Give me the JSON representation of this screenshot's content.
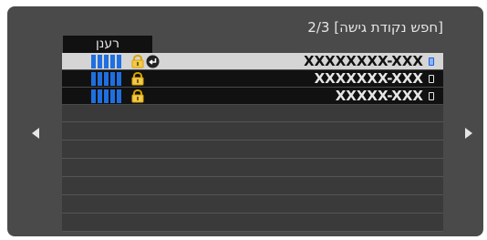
{
  "header": {
    "title": "[חפש נקודת גישה]",
    "page": "2/3"
  },
  "refresh_button": {
    "label": "רענן"
  },
  "networks": [
    {
      "ssid": "XXXXXXXX-XXX",
      "selected": true,
      "locked": true,
      "connected": true,
      "signal_bars": 5
    },
    {
      "ssid": "XXXXXXX-XXX",
      "selected": false,
      "locked": true,
      "connected": false,
      "signal_bars": 5
    },
    {
      "ssid": "XXXXX-XXX",
      "selected": false,
      "locked": true,
      "connected": false,
      "signal_bars": 5
    }
  ],
  "icons": {
    "lock": "lock-icon",
    "enter": "enter-icon",
    "signal": "signal-bars-icon",
    "prev": "chevron-left-icon",
    "next": "chevron-right-icon"
  },
  "colors": {
    "signal_blue": "#1f6fe0",
    "lock_yellow": "#f2c94c",
    "selected_row": "#d5d5d5",
    "panel_bg": "#4a4a4a"
  }
}
